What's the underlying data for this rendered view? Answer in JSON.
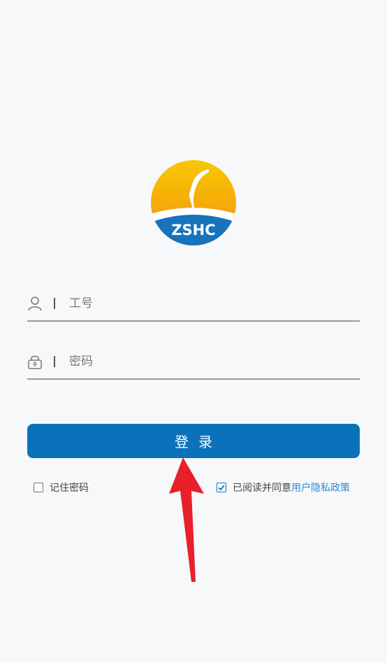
{
  "logo": {
    "text": "ZSHC",
    "colors": {
      "sun_top": "#f8c800",
      "sun_bottom": "#f07c12",
      "base": "#1773bb"
    }
  },
  "form": {
    "employee_id": {
      "placeholder": "工号",
      "value": "",
      "icon": "user-icon"
    },
    "password": {
      "placeholder": "密码",
      "value": "",
      "icon": "lock-icon"
    }
  },
  "login_button": {
    "label": "登录",
    "color": "#0a72bb"
  },
  "options": {
    "remember": {
      "label": "记住密码",
      "checked": false
    },
    "agree": {
      "label": "已阅读并同意",
      "link_label": "用户隐私政策",
      "checked": true,
      "link_color": "#2a8ad4"
    }
  },
  "annotation": {
    "type": "arrow",
    "color": "#e8202a",
    "points_to": "login-button"
  }
}
